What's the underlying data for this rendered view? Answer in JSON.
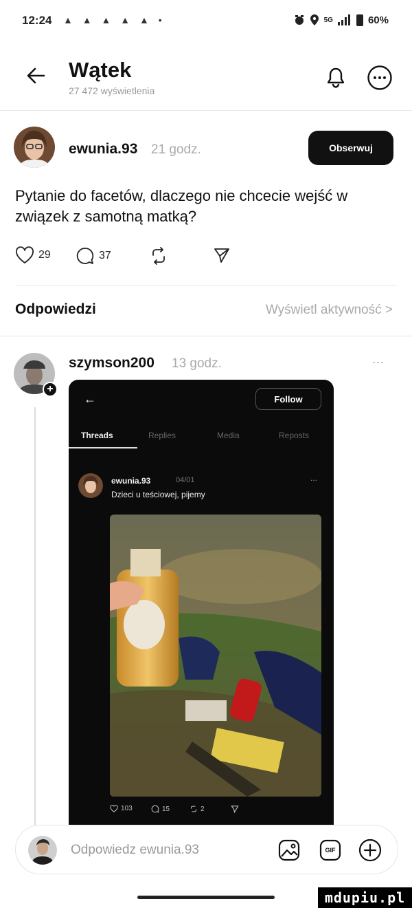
{
  "status_bar": {
    "time": "12:24",
    "notification_icons": "▲ ▲ ▲ ▲ ▲ •",
    "network": "5G",
    "battery": "60%"
  },
  "header": {
    "title": "Wątek",
    "views": "27 472 wyświetlenia"
  },
  "post": {
    "author": "ewunia.93",
    "time": "21 godz.",
    "follow_label": "Obserwuj",
    "text": "Pytanie do facetów, dlaczego nie chcecie wejść w związek z samotną matką?",
    "likes": "29",
    "comments": "37"
  },
  "replies_section": {
    "title": "Odpowiedzi",
    "activity_link": "Wyświetl aktywność >"
  },
  "reply": {
    "author": "szymson200",
    "time": "13 godz.",
    "more": "...",
    "screenshot": {
      "back": "←",
      "follow_label": "Follow",
      "tabs": [
        "Threads",
        "Replies",
        "Media",
        "Reposts"
      ],
      "inner_author": "ewunia.93",
      "inner_time": "04/01",
      "inner_more": "...",
      "inner_text": "Dzieci u teściowej, pijemy",
      "inner_likes": "103",
      "inner_comments": "15",
      "inner_reposts": "2"
    }
  },
  "composer": {
    "placeholder": "Odpowiedz ewunia.93",
    "gif_label": "GIF"
  },
  "watermark": "mdupiu.pl",
  "colors": {
    "text": "#111111",
    "muted": "#9a9a9a",
    "divider": "#e6e6e6",
    "dark_panel": "#0b0b0b"
  }
}
